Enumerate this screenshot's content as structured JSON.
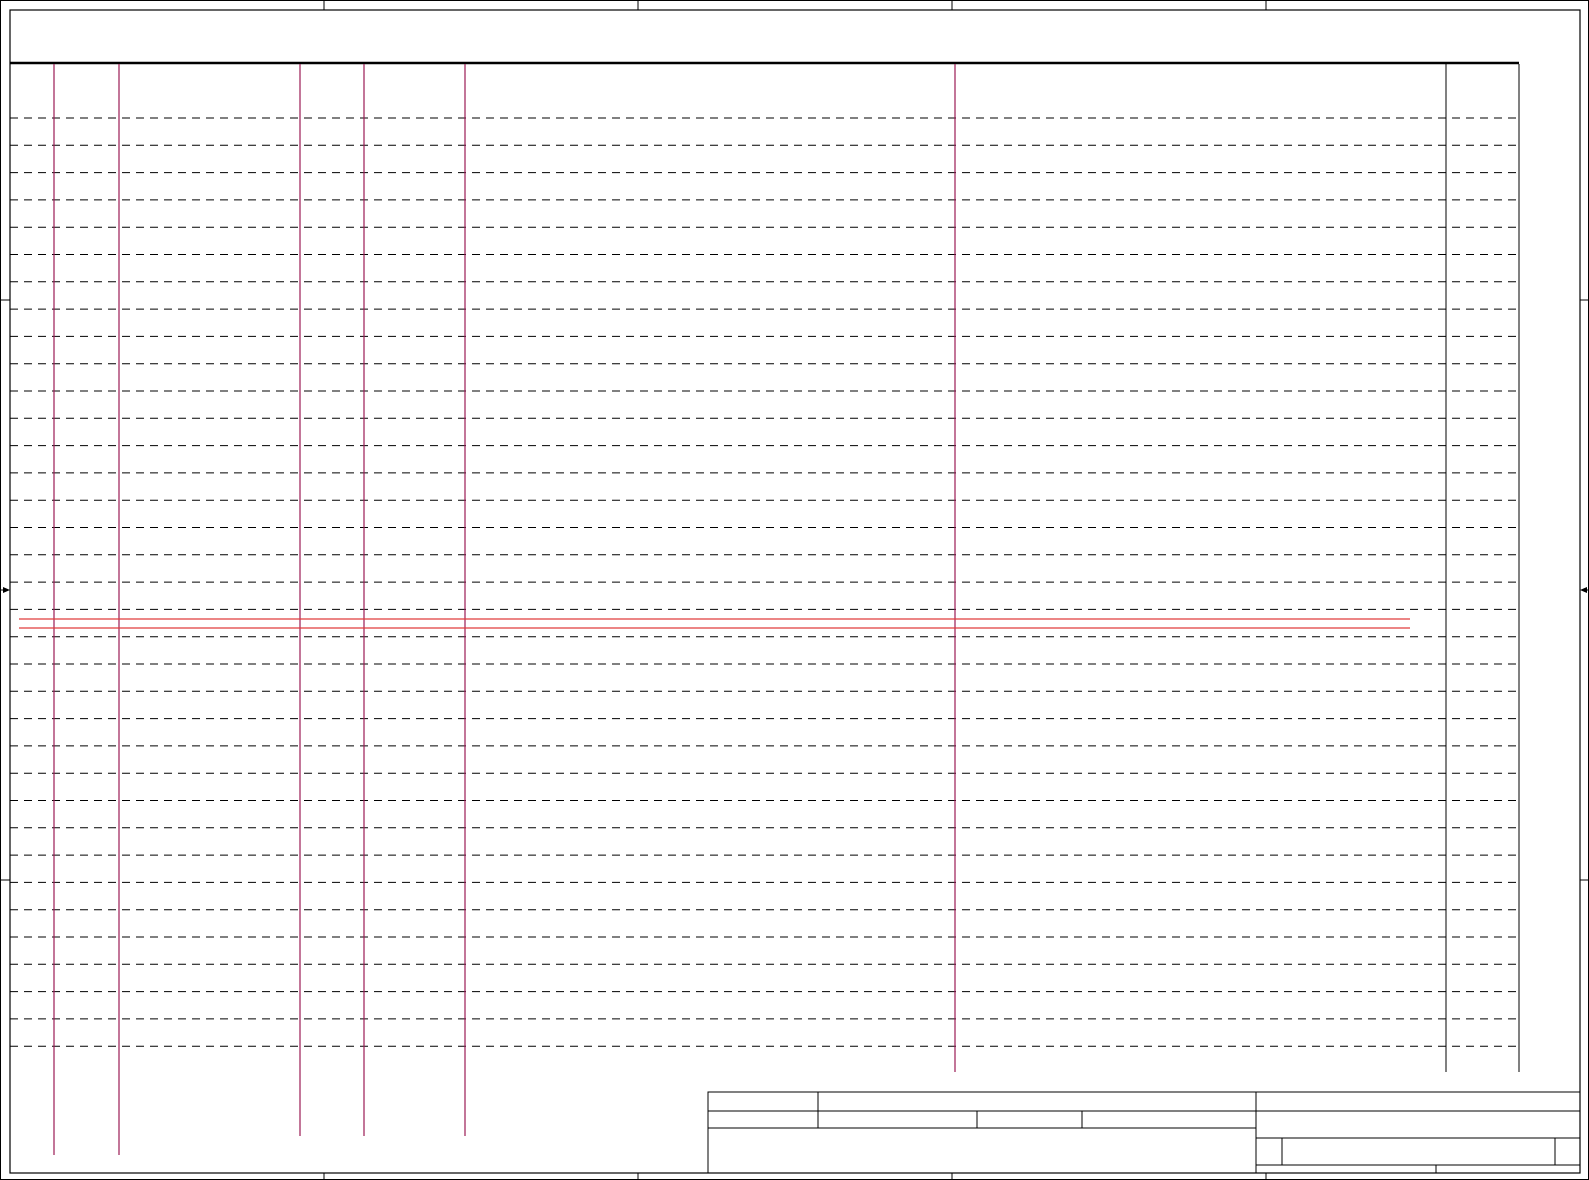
{
  "sheet": {
    "title_band": "",
    "rows": 35,
    "vertical_rule_color": "#9b1b55",
    "highlight_color": "#e03c3c",
    "line_color": "#000000"
  },
  "title_block": {
    "cells": []
  }
}
